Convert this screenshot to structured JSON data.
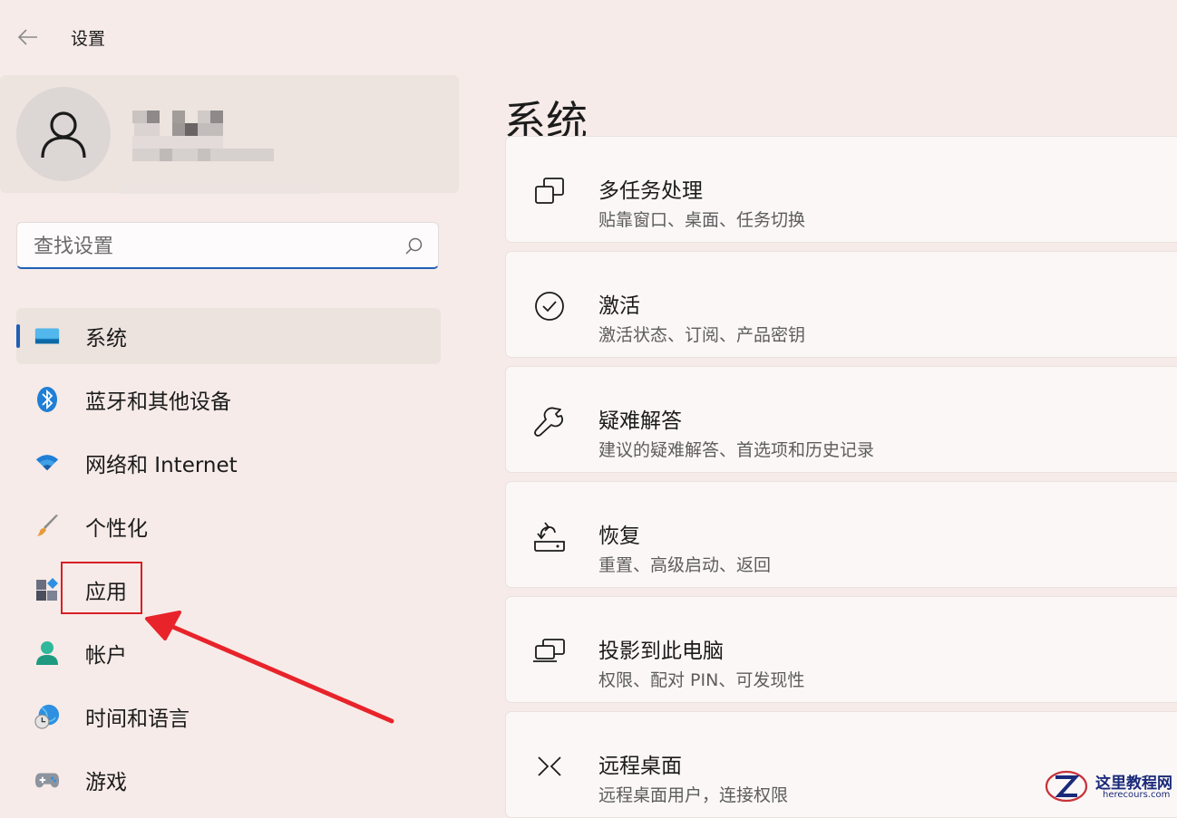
{
  "window": {
    "title": "设置"
  },
  "search": {
    "placeholder": "查找设置"
  },
  "nav": {
    "items": [
      {
        "label": "系统",
        "icon": "system-display-icon",
        "selected": true
      },
      {
        "label": "蓝牙和其他设备",
        "icon": "bluetooth-icon"
      },
      {
        "label": "网络和 Internet",
        "icon": "wifi-icon"
      },
      {
        "label": "个性化",
        "icon": "paintbrush-icon"
      },
      {
        "label": "应用",
        "icon": "apps-icon"
      },
      {
        "label": "帐户",
        "icon": "account-icon"
      },
      {
        "label": "时间和语言",
        "icon": "time-language-icon"
      },
      {
        "label": "游戏",
        "icon": "gamepad-icon"
      }
    ]
  },
  "main": {
    "title": "系统",
    "cards": [
      {
        "title": "多任务处理",
        "subtitle": "贴靠窗口、桌面、任务切换",
        "icon": "multitasking-icon"
      },
      {
        "title": "激活",
        "subtitle": "激活状态、订阅、产品密钥",
        "icon": "check-circle-icon"
      },
      {
        "title": "疑难解答",
        "subtitle": "建议的疑难解答、首选项和历史记录",
        "icon": "wrench-icon"
      },
      {
        "title": "恢复",
        "subtitle": "重置、高级启动、返回",
        "icon": "recovery-icon"
      },
      {
        "title": "投影到此电脑",
        "subtitle": "权限、配对 PIN、可发现性",
        "icon": "project-pc-icon"
      },
      {
        "title": "远程桌面",
        "subtitle": "远程桌面用户，连接权限",
        "icon": "remote-desktop-icon"
      }
    ]
  },
  "watermark": {
    "cn": "这里教程网",
    "en": "herecours.com"
  },
  "colors": {
    "accent": "#1f5fb4",
    "annotation": "#d81f26",
    "background": "#f6ebe8"
  }
}
